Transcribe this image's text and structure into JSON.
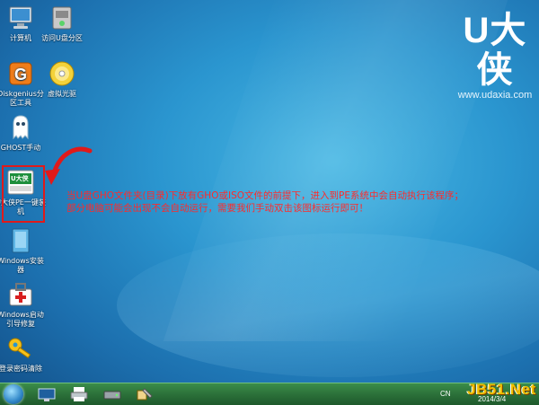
{
  "brand": {
    "logo": "U大侠",
    "url": "www.udaxia.com"
  },
  "desktop_icons": [
    {
      "name": "computer-icon",
      "label": "计算机"
    },
    {
      "name": "usb-disk-partition-icon",
      "label": "访问U盘分区"
    },
    {
      "name": "diskgenius-icon",
      "label": "Diskgenius分区工具"
    },
    {
      "name": "virtual-cd-icon",
      "label": "虚拟光驱"
    },
    {
      "name": "ghost-icon",
      "label": "GHOST手动"
    },
    {
      "name": "udaxia-installer-icon",
      "label": "U大侠PE一键装机"
    },
    {
      "name": "windows-installer-icon",
      "label": "Windows安装器"
    },
    {
      "name": "windows-boot-repair-icon",
      "label": "Windows启动引导修复"
    },
    {
      "name": "password-reset-icon",
      "label": "登录密码清除"
    }
  ],
  "installer_badge": "U大侠",
  "message": {
    "line1": "当U盘GHO文件夹(目录)下放有GHO或ISO文件的前提下，进入到PE系统中会自动执行该程序；",
    "line2": "部分电脑可能会出现不会自动运行，需要我们手动双击该图标运行即可！"
  },
  "taskbar": {
    "icons": [
      "start-orb-icon",
      "desktop-icon",
      "printer-icon",
      "drive-icon",
      "tools-icon"
    ],
    "tray_lang": "CN",
    "date": "2014/3/4"
  },
  "watermark": "JB51.Net",
  "colors": {
    "message": "#ff2a2a",
    "highlight": "#e01a1a",
    "taskbar": "#2a6e38"
  }
}
